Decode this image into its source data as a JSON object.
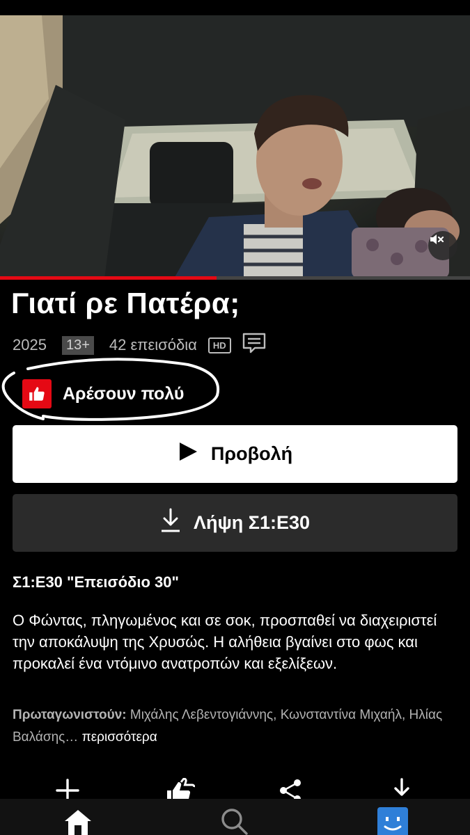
{
  "show": {
    "title": "Γιατί ρε Πατέρα;",
    "year": "2025",
    "rating": "13+",
    "episodes": "42 επεισόδια",
    "hd_label": "HD"
  },
  "hero": {
    "progress": 0.46,
    "mute_icon": "mute-icon"
  },
  "liked": {
    "label": "Αρέσουν πολύ",
    "icon": "thumbs-up-icon"
  },
  "buttons": {
    "play_label": "Προβολή",
    "download_label": "Λήψη Σ1:Ε30"
  },
  "episode": {
    "title": "Σ1:Ε30 \"Επεισόδιο 30\"",
    "synopsis": "Ο Φώντας, πληγωμένος και σε σοκ, προσπαθεί να διαχειριστεί την αποκάλυψη της Χρυσώς. Η αλήθεια βγαίνει στο φως και προκαλεί ένα ντόμινο ανατροπών και εξελίξεων."
  },
  "cast": {
    "label": "Πρωταγωνιστούν:",
    "names": " Μιχάλης Λεβεντογιάννης, Κωνσταντίνα Μιχαήλ, Ηλίας Βαλάσης… ",
    "more": "περισσότερα"
  },
  "colors": {
    "accent": "#e50914",
    "background": "#000000",
    "profile": "#2f7fd8"
  }
}
